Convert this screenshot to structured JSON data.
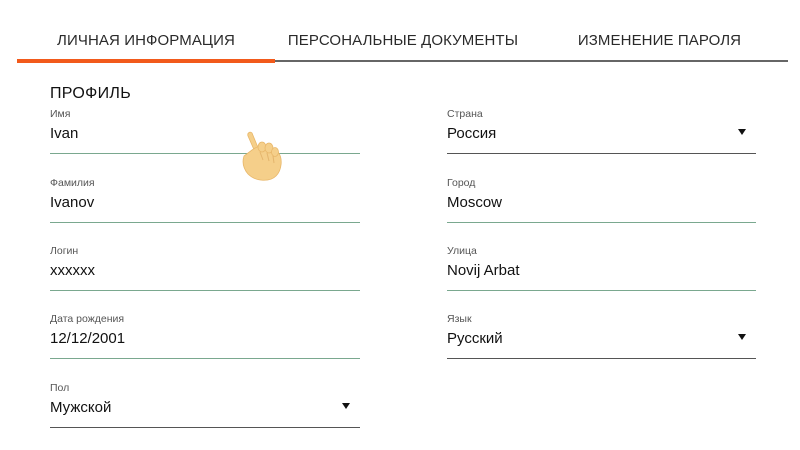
{
  "tabs": [
    {
      "label": "ЛИЧНАЯ ИНФОРМАЦИЯ",
      "active": true
    },
    {
      "label": "ПЕРСОНАЛЬНЫЕ ДОКУМЕНТЫ",
      "active": false
    },
    {
      "label": "ИЗМЕНЕНИЕ ПАРОЛЯ",
      "active": false
    }
  ],
  "colors": {
    "active_tab_underline": "#f25a1b",
    "field_underline": "#7aa88f",
    "hand_cursor": "#f5cf8a"
  },
  "profile": {
    "title": "ПРОФИЛЬ",
    "left_fields": [
      {
        "label": "Имя",
        "value": "Ivan"
      },
      {
        "label": "Фамилия",
        "value": "Ivanov"
      },
      {
        "label": "Логин",
        "value": "xxxxxx"
      },
      {
        "label": "Дата рождения",
        "value": "12/12/2001"
      },
      {
        "label": "Пол",
        "value": "Мужской",
        "type": "select"
      }
    ],
    "right_fields": [
      {
        "label": "Страна",
        "value": "Россия",
        "type": "select"
      },
      {
        "label": "Город",
        "value": "Moscow"
      },
      {
        "label": "Улица",
        "value": "Novij Arbat"
      },
      {
        "label": "Язык",
        "value": "Русский",
        "type": "select"
      }
    ]
  },
  "cursor": {
    "icon": "hand-pointer-icon"
  }
}
